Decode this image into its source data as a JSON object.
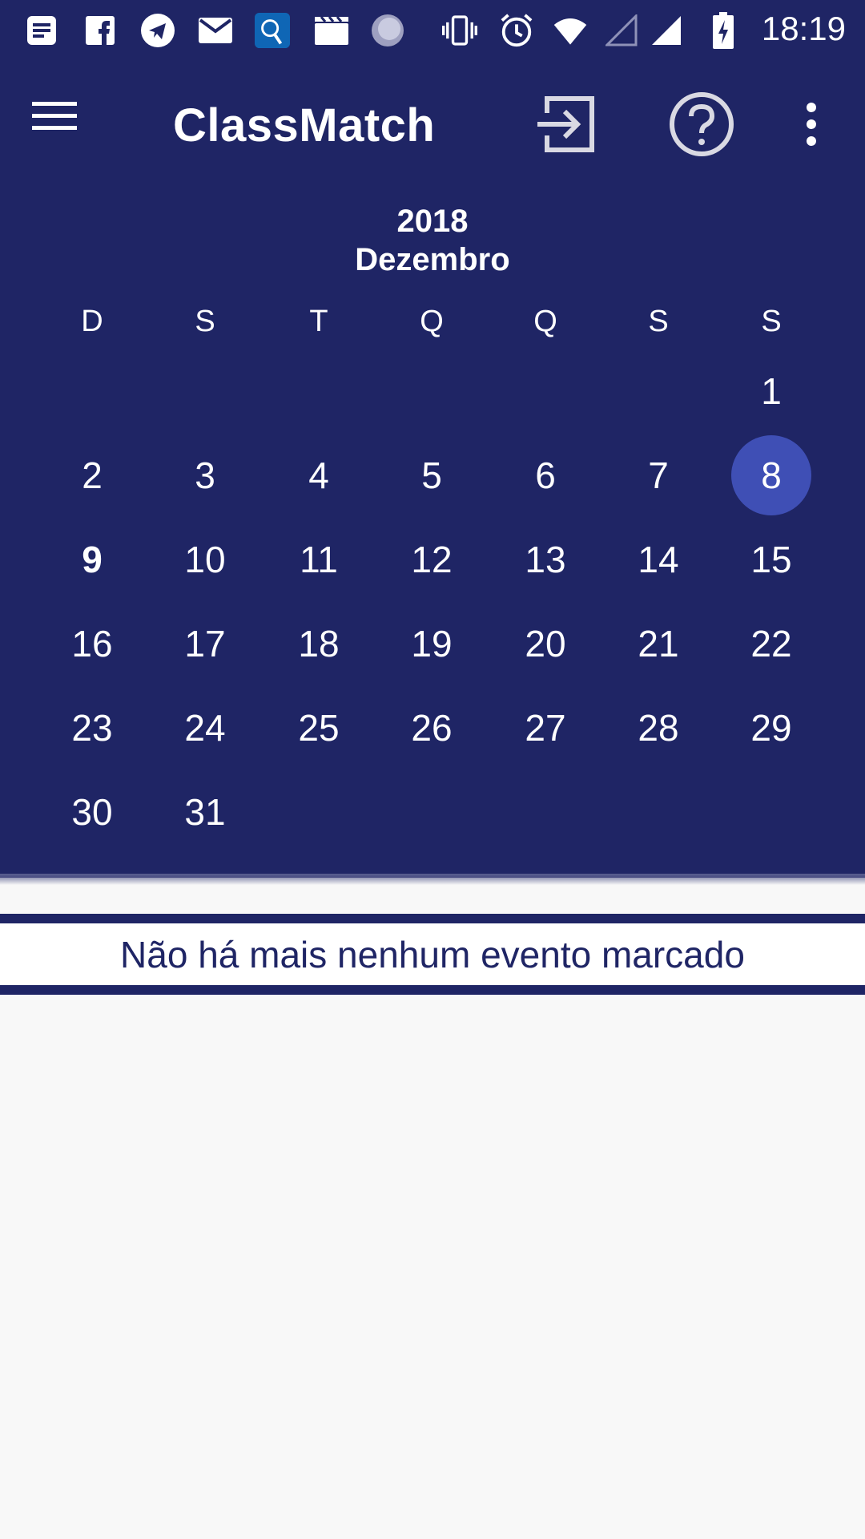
{
  "status_bar": {
    "time": "18:19",
    "icons": [
      "notes-icon",
      "facebook-icon",
      "telegram-icon",
      "mail-icon",
      "app-badge-icon",
      "clapperboard-icon",
      "loading-icon",
      "vibrate-icon",
      "alarm-icon",
      "wifi-icon",
      "signal-empty-icon",
      "signal-icon",
      "battery-charging-icon"
    ]
  },
  "app_bar": {
    "title": "ClassMatch",
    "actions": [
      "login-icon",
      "help-icon",
      "more-options-icon"
    ]
  },
  "calendar": {
    "year": "2018",
    "month": "Dezembro",
    "weekdays": [
      "D",
      "S",
      "T",
      "Q",
      "Q",
      "S",
      "S"
    ],
    "weeks": [
      [
        "",
        "",
        "",
        "",
        "",
        "",
        "1"
      ],
      [
        "2",
        "3",
        "4",
        "5",
        "6",
        "7",
        "8"
      ],
      [
        "9",
        "10",
        "11",
        "12",
        "13",
        "14",
        "15"
      ],
      [
        "16",
        "17",
        "18",
        "19",
        "20",
        "21",
        "22"
      ],
      [
        "23",
        "24",
        "25",
        "26",
        "27",
        "28",
        "29"
      ],
      [
        "30",
        "31",
        "",
        "",
        "",
        "",
        ""
      ]
    ],
    "selected_day": "8",
    "today": "9"
  },
  "events": {
    "message": "Não há mais nenhum evento marcado"
  },
  "colors": {
    "primary": "#1f2565",
    "selected": "#3f4fb5",
    "background": "#f8f8f8"
  }
}
